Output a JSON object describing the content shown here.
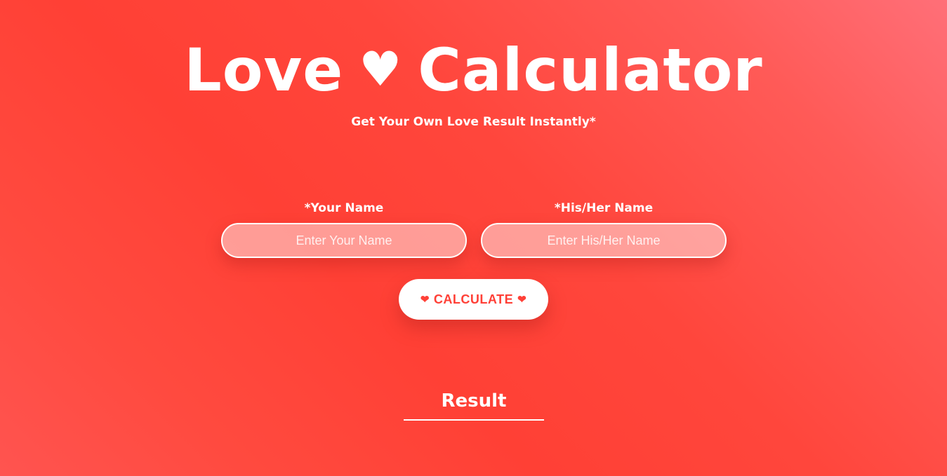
{
  "header": {
    "title_part1": "Love",
    "title_heart": "♥",
    "title_part2": "Calculator",
    "subtitle": "Get Your Own Love Result Instantly*"
  },
  "form": {
    "your_name_label": "*Your Name",
    "your_name_placeholder": "Enter Your Name",
    "your_name_value": "",
    "partner_name_label": "*His/Her Name",
    "partner_name_placeholder": "Enter His/Her Name",
    "partner_name_value": "",
    "calculate_label": "CALCULATE",
    "calculate_heart": "❤"
  },
  "result": {
    "heading": "Result"
  },
  "colors": {
    "background_start": "#ff4035",
    "background_end": "#ff6f78",
    "button_background": "#ffffff",
    "button_text": "#ff4037",
    "text": "#ffffff"
  },
  "icons": {
    "title_heart": "heart-icon",
    "button_hearts": "heart-icon"
  }
}
